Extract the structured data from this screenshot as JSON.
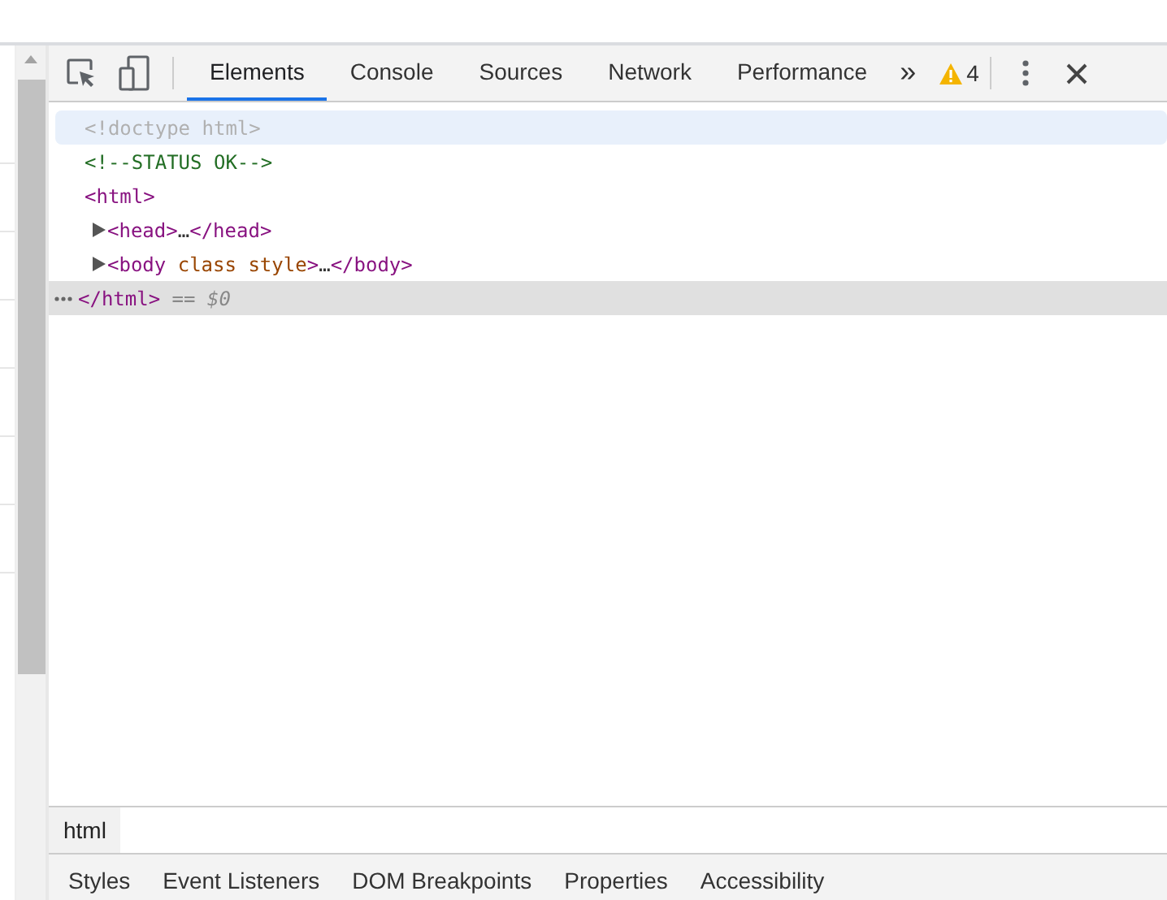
{
  "toolbar": {
    "tabs": [
      {
        "label": "Elements",
        "selected": true
      },
      {
        "label": "Console",
        "selected": false
      },
      {
        "label": "Sources",
        "selected": false
      },
      {
        "label": "Network",
        "selected": false
      },
      {
        "label": "Performance",
        "selected": false
      }
    ],
    "overflow": "»",
    "warnings": "4"
  },
  "tree": [
    {
      "parts": [
        {
          "kind": "doctype",
          "text": "<!doctype html>"
        }
      ],
      "hovered": true,
      "selected": false
    },
    {
      "parts": [
        {
          "kind": "comment",
          "text": "<!--STATUS OK-->"
        }
      ],
      "hovered": false,
      "selected": false
    },
    {
      "parts": [
        {
          "kind": "tag",
          "text": "<html>"
        }
      ],
      "hovered": false,
      "selected": false,
      "children": [
        {
          "parts": [
            {
              "kind": "tag",
              "text": "<head>"
            },
            {
              "kind": "plain",
              "text": "…"
            },
            {
              "kind": "tag",
              "text": "</head>"
            }
          ],
          "expandable": true,
          "expanded": false,
          "hovered": false,
          "selected": false
        },
        {
          "parts": [
            {
              "kind": "tag",
              "text": "<body"
            },
            {
              "kind": "attr",
              "text": " class"
            },
            {
              "kind": "attr",
              "text": " style"
            },
            {
              "kind": "tag",
              "text": ">"
            },
            {
              "kind": "plain",
              "text": "…"
            },
            {
              "kind": "tag",
              "text": "</body>"
            }
          ],
          "expandable": true,
          "expanded": false,
          "hovered": false,
          "selected": false
        }
      ]
    },
    {
      "parts": [
        {
          "kind": "tag",
          "text": "</html>"
        },
        {
          "kind": "ref",
          "text": " == $0"
        }
      ],
      "hovered": false,
      "selected": true
    }
  ],
  "breadcrumbs": [
    {
      "label": "html",
      "selected": true
    }
  ],
  "panel_tabs": [
    {
      "label": "Styles",
      "selected": false
    },
    {
      "label": "Event Listeners",
      "selected": false
    },
    {
      "label": "DOM Breakpoints",
      "selected": false
    },
    {
      "label": "Properties",
      "selected": false
    },
    {
      "label": "Accessibility",
      "selected": false
    }
  ]
}
